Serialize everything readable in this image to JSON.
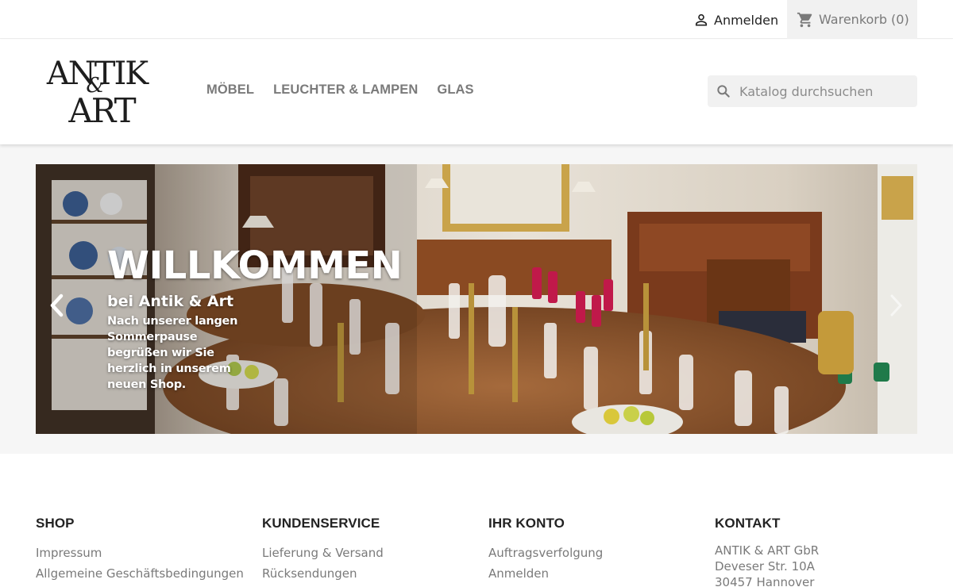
{
  "topbar": {
    "signin_label": "Anmelden",
    "cart_label": "Warenkorb",
    "cart_count": "(0)"
  },
  "header": {
    "logo_alt": "Antik & Art",
    "nav": [
      {
        "label": "MÖBEL"
      },
      {
        "label": "LEUCHTER & LAMPEN"
      },
      {
        "label": "GLAS"
      }
    ],
    "search": {
      "placeholder": "Katalog durchsuchen",
      "value": ""
    }
  },
  "hero": {
    "title": "WILLKOMMEN",
    "subtitle": "bei Antik & Art",
    "text": "Nach unserer langen Sommerpause begrüßen wir Sie herzlich in unserem neuen Shop."
  },
  "footer": {
    "shop": {
      "title": "SHOP",
      "links": [
        "Impressum",
        "Allgemeine Geschäftsbedingungen"
      ]
    },
    "service": {
      "title": "KUNDENSERVICE",
      "links": [
        "Lieferung & Versand",
        "Rücksendungen"
      ]
    },
    "account": {
      "title": "IHR KONTO",
      "links": [
        "Auftragsverfolgung",
        "Anmelden"
      ]
    },
    "contact": {
      "title": "KONTAKT",
      "lines": [
        "ANTIK & ART GbR",
        "Deveser Str. 10A",
        "30457 Hannover"
      ]
    }
  },
  "colors": {
    "text_dark": "#232323",
    "text_grey": "#7a7a7a",
    "bar_bg": "#f1f1f1",
    "hero_bg": "#f6f6f6"
  },
  "icons": [
    "user-icon",
    "cart-icon",
    "search-icon",
    "chevron-left-icon",
    "chevron-right-icon"
  ]
}
